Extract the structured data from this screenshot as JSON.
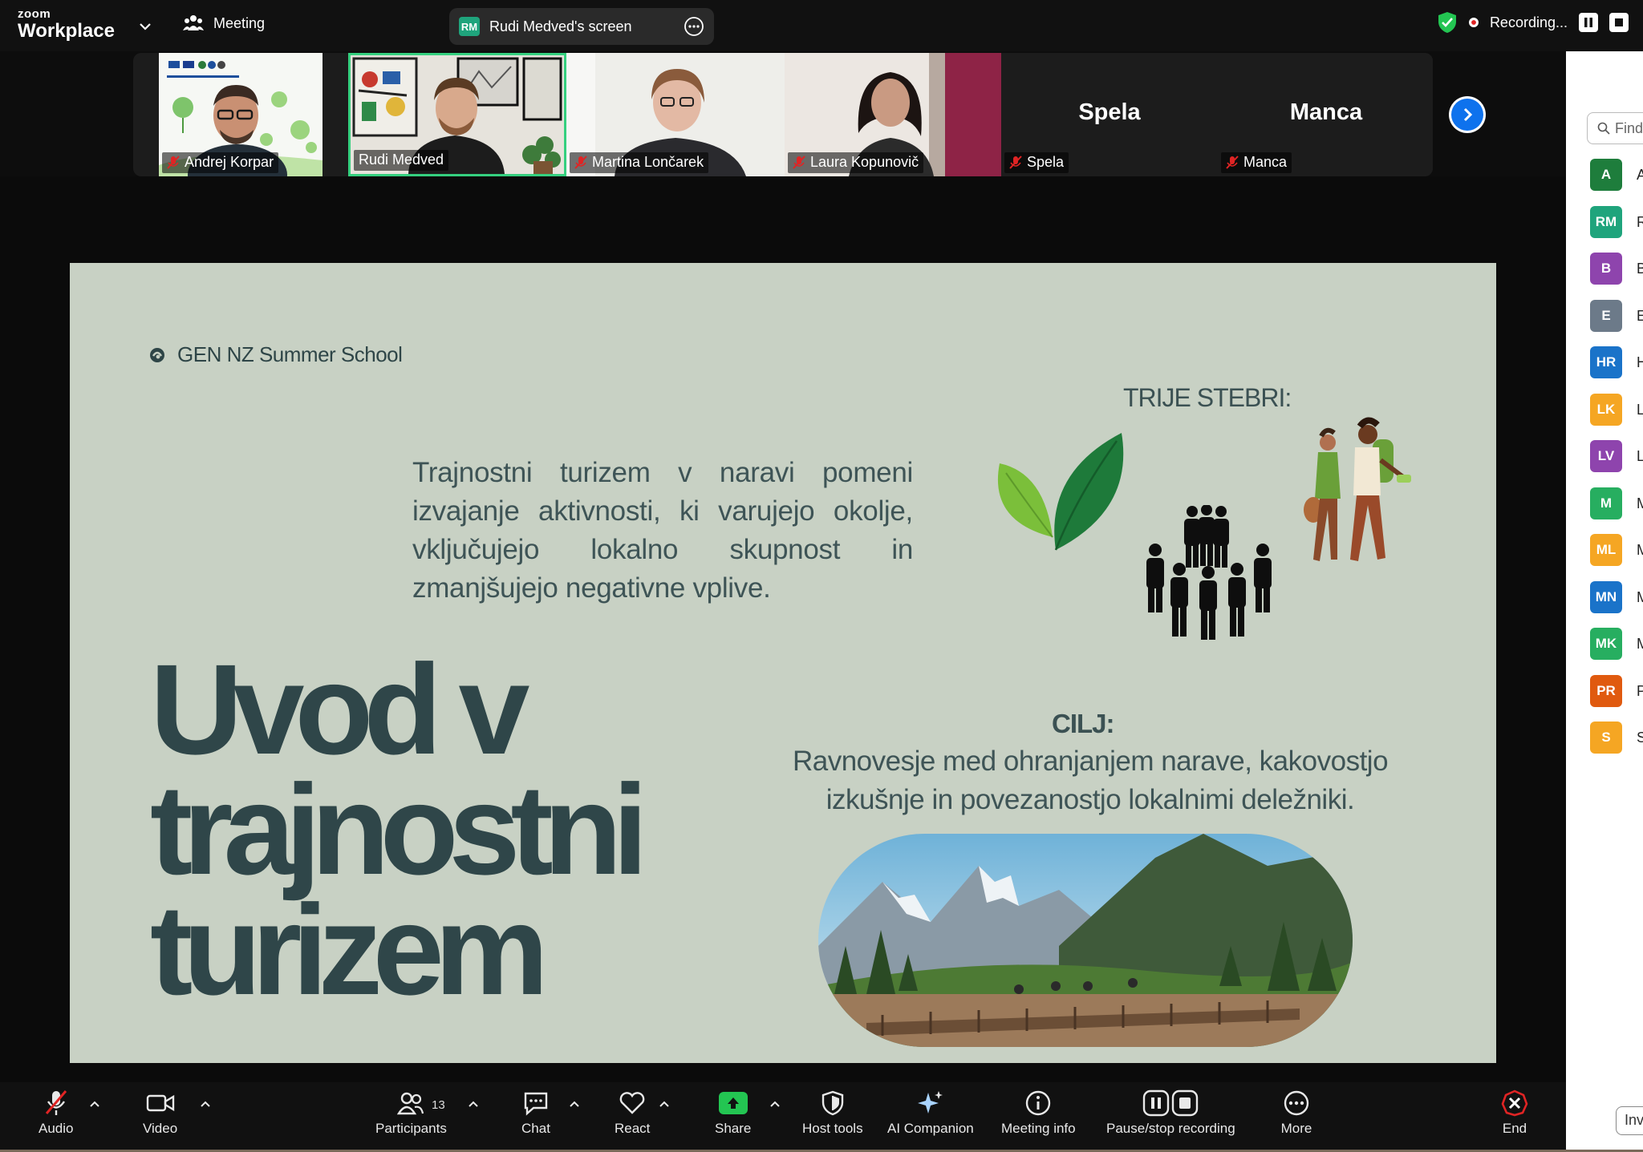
{
  "app": {
    "brand": "zoom",
    "product": "Workplace",
    "meeting_label": "Meeting"
  },
  "screen_share": {
    "badge": "RM",
    "label": "Rudi Medved's screen"
  },
  "recording": {
    "label": "Recording..."
  },
  "participants_strip": [
    {
      "name": "Andrej Korpar",
      "muted": true,
      "video": true
    },
    {
      "name": "Rudi Medved",
      "muted": false,
      "video": true,
      "active_speaker": true
    },
    {
      "name": "Martina Lončarek",
      "muted": true,
      "video": true
    },
    {
      "name": "Laura Kopunovič",
      "muted": true,
      "video": true
    },
    {
      "name": "Spela",
      "muted": true,
      "video": false,
      "display": "Spela"
    },
    {
      "name": "Manca",
      "muted": true,
      "video": false,
      "display": "Manca"
    }
  ],
  "slide": {
    "brand": "GEN NZ Summer School",
    "body": "Trajnostni turizem v naravi pomeni izvajanje aktivnosti, ki varujejo okolje, vključujejo lokalno skupnost in zmanjšujejo negativne vplive.",
    "title_line1": "Uvod v",
    "title_line2": "trajnostni",
    "title_line3": "turizem",
    "pillars_title": "TRIJE STEBRI:",
    "goal_title": "CILJ:",
    "goal_text": "Ravnovesje med ohranjanjem narave, kakovostjo izkušnje in povezanostjo lokalnimi deležniki."
  },
  "side_panel": {
    "search_placeholder": "Find",
    "participants": [
      {
        "initials": "A",
        "color": "#1e7d3c",
        "letter": "A"
      },
      {
        "initials": "RM",
        "color": "#1fa47c",
        "letter": "R"
      },
      {
        "initials": "B",
        "color": "#8e44ad",
        "letter": "B"
      },
      {
        "initials": "E",
        "color": "#6c7a89",
        "letter": "E"
      },
      {
        "initials": "HR",
        "color": "#1a73c9",
        "letter": "H"
      },
      {
        "initials": "LK",
        "color": "#f5a623",
        "letter": "L"
      },
      {
        "initials": "LV",
        "color": "#8e44ad",
        "letter": "L"
      },
      {
        "initials": "M",
        "color": "#27ae60",
        "letter": "M"
      },
      {
        "initials": "ML",
        "color": "#f5a623",
        "letter": "M"
      },
      {
        "initials": "MN",
        "color": "#1a73c9",
        "letter": "M"
      },
      {
        "initials": "MK",
        "color": "#27ae60",
        "letter": "M"
      },
      {
        "initials": "PR",
        "color": "#e05a0f",
        "letter": "P"
      },
      {
        "initials": "S",
        "color": "#f5a623",
        "letter": "S"
      }
    ],
    "invite_label": "Inv"
  },
  "toolbar": {
    "audio": "Audio",
    "video": "Video",
    "participants": "Participants",
    "participants_count": "13",
    "chat": "Chat",
    "react": "React",
    "share": "Share",
    "host_tools": "Host tools",
    "ai_companion": "AI Companion",
    "meeting_info": "Meeting info",
    "pause_stop_recording": "Pause/stop recording",
    "more": "More",
    "end": "End"
  }
}
